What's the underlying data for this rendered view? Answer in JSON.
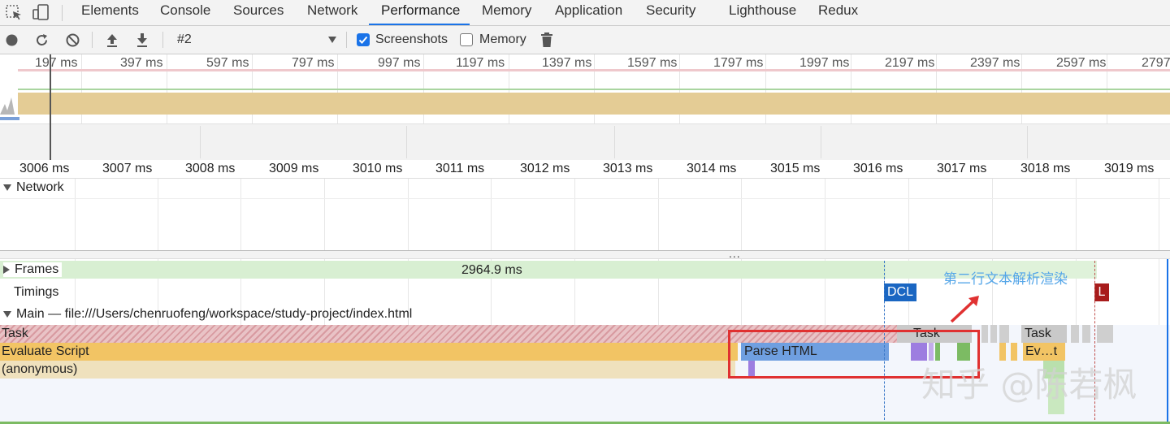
{
  "tabs": [
    "Elements",
    "Console",
    "Sources",
    "Network",
    "Performance",
    "Memory",
    "Application",
    "Security",
    "Lighthouse",
    "Redux"
  ],
  "active_tab": "Performance",
  "toolbar": {
    "profile_select": "#2",
    "screenshots_label": "Screenshots",
    "screenshots_checked": true,
    "memory_label": "Memory",
    "memory_checked": false
  },
  "overview": {
    "ticks": [
      "197 ms",
      "397 ms",
      "597 ms",
      "797 ms",
      "997 ms",
      "1197 ms",
      "1397 ms",
      "1597 ms",
      "1797 ms",
      "1997 ms",
      "2197 ms",
      "2397 ms",
      "2597 ms",
      "2797"
    ]
  },
  "ruler": {
    "ticks": [
      "3006 ms",
      "3007 ms",
      "3008 ms",
      "3009 ms",
      "3010 ms",
      "3011 ms",
      "3012 ms",
      "3013 ms",
      "3014 ms",
      "3015 ms",
      "3016 ms",
      "3017 ms",
      "3018 ms",
      "3019 ms"
    ]
  },
  "tracks": {
    "network_label": "Network",
    "frames_label": "Frames",
    "frames_duration": "2964.9 ms",
    "timings_label": "Timings",
    "dcl_marker": "DCL",
    "l_marker": "L",
    "main_label": "Main — file:///Users/chenruofeng/workspace/study-project/index.html",
    "more_dots": "..."
  },
  "flame": {
    "task": "Task",
    "task2": "Task",
    "task3": "Task",
    "evaluate_script": "Evaluate Script",
    "parse_html": "Parse HTML",
    "ev_t": "Ev…t",
    "anonymous": "(anonymous)"
  },
  "annotation": {
    "text": "第二行文本解析渲染",
    "watermark": "知乎 @陈若枫"
  },
  "colors": {
    "accent": "#1a73e8",
    "task_hatch": "#d89aa0",
    "evaluate_script": "#f2c464",
    "anonymous": "#efe1bd",
    "parse_html": "#6f9fe0",
    "frames": "#d8efd2",
    "dcl": "#1a66c2",
    "load": "#a81c1c",
    "annotation_red": "#e03131",
    "annotation_text": "#55a6e8"
  }
}
